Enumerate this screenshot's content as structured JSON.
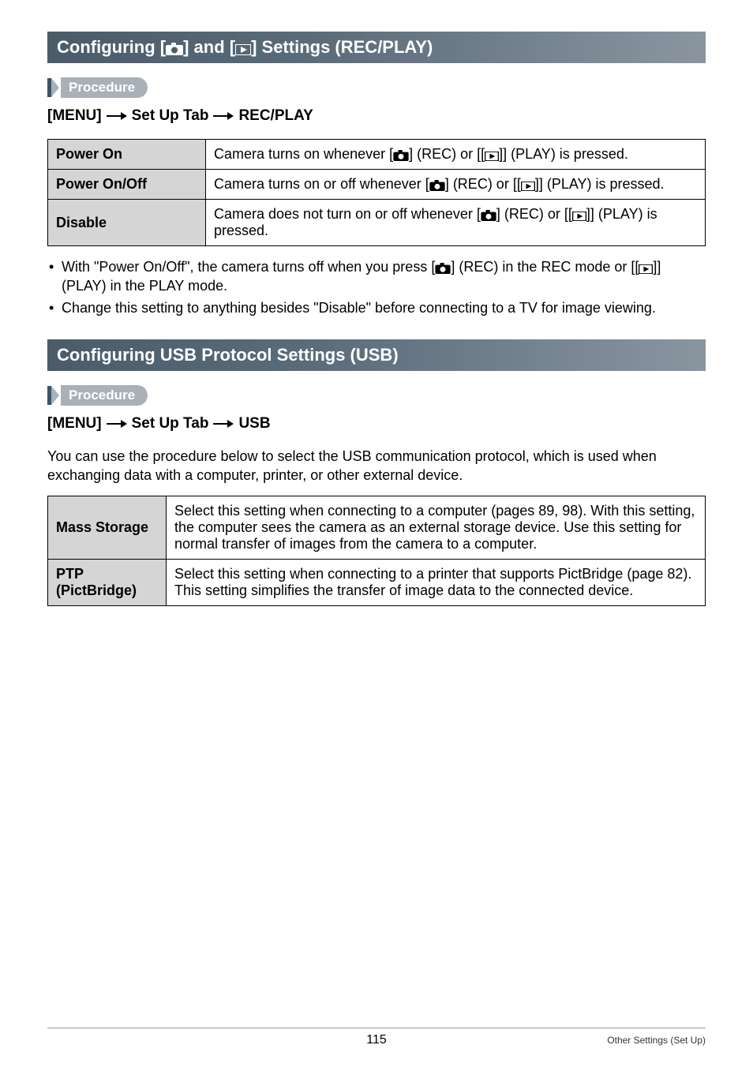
{
  "sections": [
    {
      "title": "Configuring [r] and [p] Settings (REC/PLAY)",
      "procedure_label": "Procedure",
      "menu_path": [
        "[MENU]",
        "Set Up Tab",
        "REC/PLAY"
      ],
      "table": {
        "rows": [
          {
            "label": "Power On",
            "desc_prefix": "Camera turns on whenever [",
            "desc_mid": "] (REC) or [[",
            "desc_suffix": "]] (PLAY) is pressed."
          },
          {
            "label": "Power On/Off",
            "desc_prefix": "Camera turns on or off whenever [",
            "desc_mid": "] (REC) or [[",
            "desc_suffix": "]] (PLAY) is pressed."
          },
          {
            "label": "Disable",
            "desc_prefix": "Camera does not turn on or off whenever [",
            "desc_mid": "] (REC) or [[",
            "desc_suffix": "]] (PLAY) is pressed."
          }
        ]
      },
      "bullets": [
        "With \"Power On/Off\", the camera turns off when you press [REC_ICON] (REC) in the REC mode or [[PLAY_ICON]] (PLAY) in the PLAY mode.",
        "Change this setting to anything besides \"Disable\" before connecting to a TV for image viewing."
      ]
    },
    {
      "title": "Configuring USB Protocol Settings (USB)",
      "procedure_label": "Procedure",
      "menu_path": [
        "[MENU]",
        "Set Up Tab",
        "USB"
      ],
      "intro": "You can use the procedure below to select the USB communication protocol, which is used when exchanging data with a computer, printer, or other external device.",
      "table": {
        "rows": [
          {
            "label": "Mass Storage",
            "desc": "Select this setting when connecting to a computer (pages 89, 98). With this setting, the computer sees the camera as an external storage device. Use this setting for normal transfer of images from the camera to a computer."
          },
          {
            "label": "PTP (PictBridge)",
            "desc": "Select this setting when connecting to a printer that supports PictBridge (page 82). This setting simplifies the transfer of image data to the connected device."
          }
        ]
      }
    }
  ],
  "footer": {
    "page": "115",
    "caption": "Other Settings (Set Up)"
  },
  "icons": {
    "rec": "camera-icon",
    "play": "play-icon",
    "arrow": "arrow-right-icon"
  }
}
